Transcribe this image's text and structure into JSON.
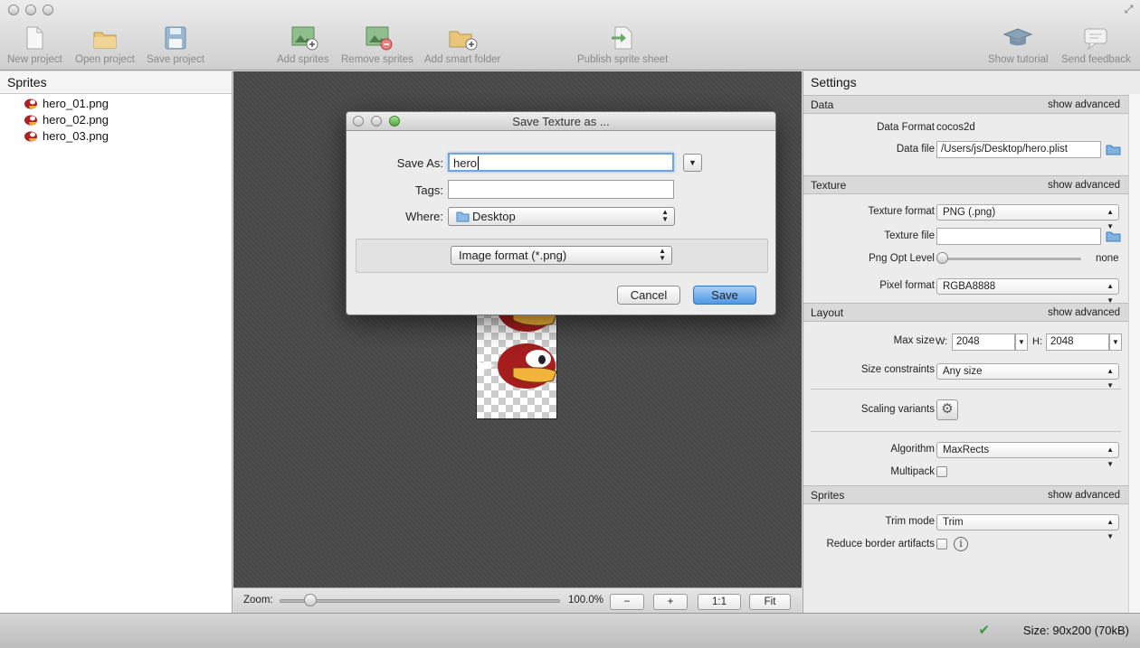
{
  "toolbar": {
    "new_project": "New project",
    "open_project": "Open project",
    "save_project": "Save project",
    "add_sprites": "Add sprites",
    "remove_sprites": "Remove sprites",
    "add_smart_folder": "Add smart folder",
    "publish": "Publish sprite sheet",
    "show_tutorial": "Show tutorial",
    "send_feedback": "Send feedback"
  },
  "sprites_panel": {
    "title": "Sprites",
    "items": [
      {
        "label": "hero_01.png"
      },
      {
        "label": "hero_02.png"
      },
      {
        "label": "hero_03.png"
      }
    ]
  },
  "zoom": {
    "label": "Zoom:",
    "value": "100.0%",
    "level": 1.0,
    "minus": "−",
    "plus": "+",
    "one_to_one": "1:1",
    "fit": "Fit"
  },
  "settings": {
    "title": "Settings",
    "data": {
      "header": "Data",
      "show_advanced": "show advanced",
      "data_format_label": "Data Format",
      "data_format_value": "cocos2d",
      "data_file_label": "Data file",
      "data_file_value": "/Users/js/Desktop/hero.plist"
    },
    "texture": {
      "header": "Texture",
      "show_advanced": "show advanced",
      "texture_format_label": "Texture format",
      "texture_format_value": "PNG (.png)",
      "texture_file_label": "Texture file",
      "texture_file_value": "",
      "png_opt_label": "Png Opt Level",
      "png_opt_value": "none",
      "pixel_format_label": "Pixel format",
      "pixel_format_value": "RGBA8888"
    },
    "layout": {
      "header": "Layout",
      "show_advanced": "show advanced",
      "max_size_label": "Max size",
      "w_label": "W:",
      "w_value": "2048",
      "h_label": "H:",
      "h_value": "2048",
      "size_constraints_label": "Size constraints",
      "size_constraints_value": "Any size",
      "scaling_variants_label": "Scaling variants",
      "algorithm_label": "Algorithm",
      "algorithm_value": "MaxRects",
      "multipack_label": "Multipack"
    },
    "sprites": {
      "header": "Sprites",
      "show_advanced": "show advanced",
      "trim_mode_label": "Trim mode",
      "trim_mode_value": "Trim",
      "reduce_artifacts_label": "Reduce border artifacts"
    }
  },
  "status": {
    "text": "Size: 90x200 (70kB)"
  },
  "dialog": {
    "title": "Save Texture as ...",
    "save_as_label": "Save As:",
    "save_as_value": "hero",
    "tags_label": "Tags:",
    "tags_value": "",
    "where_label": "Where:",
    "where_value": "Desktop",
    "format_value": "Image format (*.png)",
    "cancel": "Cancel",
    "save": "Save"
  },
  "colors": {
    "accent": "#5ca0e6",
    "canvas": "#4a4a4a",
    "ok": "#3b9a3b"
  }
}
